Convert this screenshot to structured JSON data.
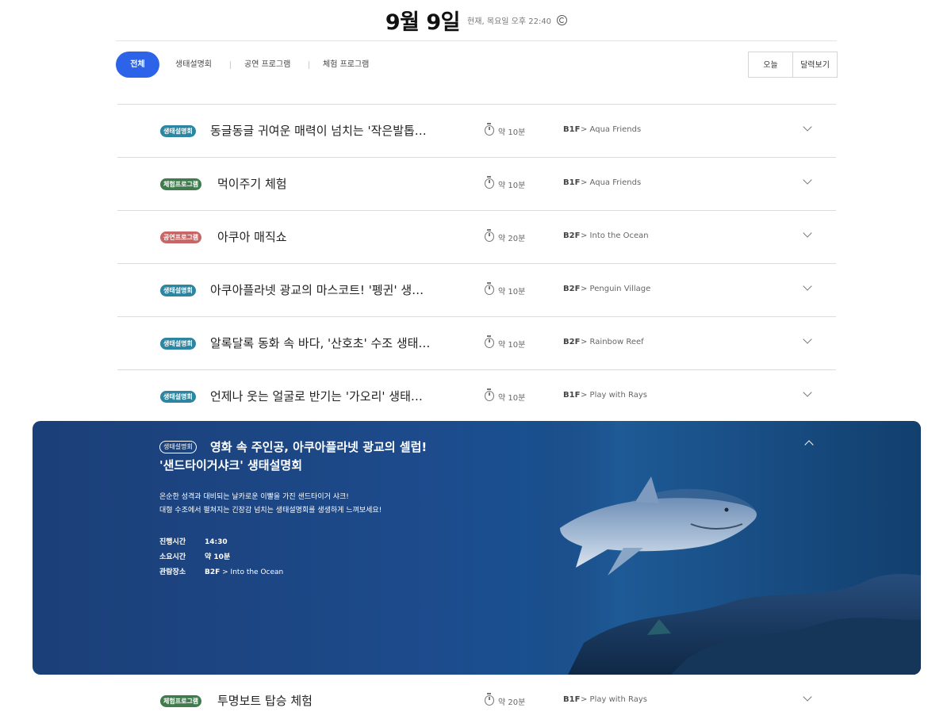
{
  "header": {
    "date_title": "9월 9일",
    "now_text": "현재, 목요일 오후 22:40",
    "refresh_icon": "refresh-icon"
  },
  "filters": {
    "tabs": [
      "전체",
      "생태설명회",
      "공연 프로그램",
      "체험 프로그램"
    ],
    "active_tab": "전체",
    "today_label": "오늘",
    "calendar_label": "달력보기"
  },
  "colors": {
    "accent": "#2c63e8",
    "badge_eco": "#2d86a1",
    "badge_experience": "#3f7b4d",
    "badge_performance": "#c66666",
    "detail_bg": "#1b3f78"
  },
  "programs": [
    {
      "badge": "생태설명회",
      "title": "동글동글 귀여운 매력이 넘치는 '작은발톱…",
      "duration": "약 10분",
      "floor": "B1F",
      "zone": "> Aqua Friends"
    },
    {
      "badge": "체험프로그램",
      "title": "먹이주기 체험",
      "duration": "약 10분",
      "floor": "B1F",
      "zone": "> Aqua Friends"
    },
    {
      "badge": "공연프로그램",
      "title": "아쿠아 매직쇼",
      "duration": "약 20분",
      "floor": "B2F",
      "zone": "> Into the Ocean"
    },
    {
      "badge": "생태설명회",
      "title": "아쿠아플라넷 광교의 마스코트! '펭귄' 생…",
      "duration": "약 10분",
      "floor": "B2F",
      "zone": "> Penguin Village"
    },
    {
      "badge": "생태설명회",
      "title": "알록달록 동화 속 바다, '산호초' 수조 생태…",
      "duration": "약 10분",
      "floor": "B2F",
      "zone": "> Rainbow Reef"
    },
    {
      "badge": "생태설명회",
      "title": "언제나 웃는 얼굴로 반기는 '가오리' 생태…",
      "duration": "약 10분",
      "floor": "B1F",
      "zone": "> Play with Rays"
    }
  ],
  "detail": {
    "badge": "생태설명회",
    "title_line1": "영화 속 주인공, 아쿠아플라넷 광교의 셀럽!",
    "title_line2": "'샌드타이거샤크' 생태설명회",
    "desc_line1": "온순한 성격과 대비되는 날카로운 이빨을 가진 샌드타이거 샤크!",
    "desc_line2": "대형 수조에서 펼쳐지는 긴장감 넘치는 생태설명회를 생생하게 느껴보세요!",
    "time_label": "진행시간",
    "time_value": "14:30",
    "duration_label": "소요시간",
    "duration_value": "약 10분",
    "place_label": "관람장소",
    "place_floor": "B2F",
    "place_zone": "> Into the Ocean"
  },
  "last_program": {
    "badge": "체험프로그램",
    "title": "투명보트 탑승 체험",
    "duration": "약 20분",
    "floor": "B1F",
    "zone": "> Play with Rays"
  }
}
